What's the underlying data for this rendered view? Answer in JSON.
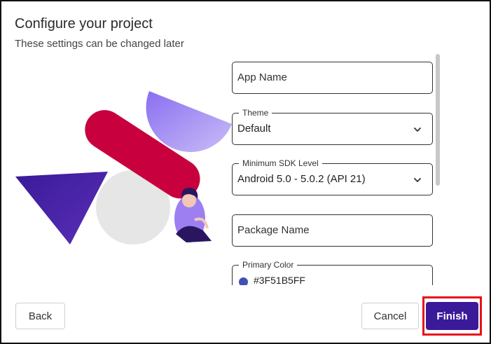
{
  "dialog": {
    "title": "Configure your project",
    "subtitle": "These settings can be changed later"
  },
  "form": {
    "app_name": {
      "placeholder": "App Name"
    },
    "theme": {
      "label": "Theme",
      "value": "Default",
      "icon": "chevron-down-icon"
    },
    "min_sdk": {
      "label": "Minimum SDK Level",
      "value": "Android 5.0 - 5.0.2 (API 21)",
      "icon": "chevron-down-icon"
    },
    "package_name": {
      "placeholder": "Package Name"
    },
    "primary_color": {
      "label": "Primary Color",
      "value": "#3F51B5FF",
      "swatch": "#3F51B5"
    }
  },
  "footer": {
    "back_label": "Back",
    "cancel_label": "Cancel",
    "finish_label": "Finish"
  },
  "colors": {
    "accent": "#3a1a98",
    "highlight": "#e8101a",
    "crimson": "#c8003e",
    "lavender": "#a48ff0",
    "indigo": "#4a1fa0"
  }
}
